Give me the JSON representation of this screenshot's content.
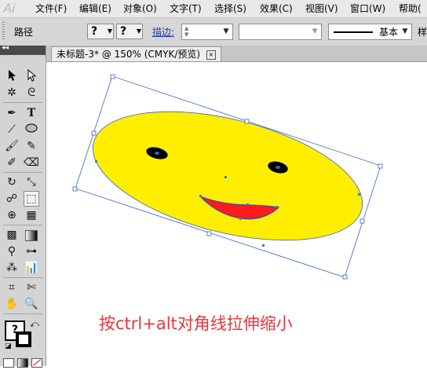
{
  "menubar": {
    "logo": "Ai",
    "items": [
      "文件(F)",
      "编辑(E)",
      "对象(O)",
      "文字(T)",
      "选择(S)",
      "效果(C)",
      "视图(V)",
      "窗口(W)",
      "帮助("
    ]
  },
  "control": {
    "mode_label": "路径",
    "fill_glyph": "?",
    "stroke_glyph": "?",
    "stroke_label": "描边:",
    "basic_label": "基本",
    "style_label": "样"
  },
  "document": {
    "tab_title": "未标题-3* @ 150% (CMYK/预览)",
    "close_glyph": "×"
  },
  "canvas": {
    "caption": "按ctrl+alt对角线拉伸缩小",
    "colors": {
      "face": "#ffee00",
      "mouth": "#ff1b1b",
      "bbox": "#4d74c8",
      "caption": "#e8353e"
    }
  },
  "tools": {
    "selection": "selection-tool-icon",
    "direct_selection": "direct-selection-tool-icon",
    "type_glyph": "T"
  },
  "colors": {
    "menubar": "#e9e9e9",
    "controlbar": "#d6d6d6",
    "toolpanel": "#d4d4d4",
    "accent_label": "#1a3aa6"
  }
}
